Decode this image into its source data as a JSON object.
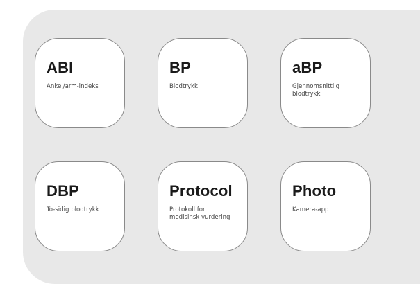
{
  "tiles": [
    {
      "title": "ABI",
      "description": "Ankel/arm-indeks"
    },
    {
      "title": "BP",
      "description": "Blodtrykk"
    },
    {
      "title": "aBP",
      "description": "Gjennomsnittlig\nblodtrykk"
    },
    {
      "title": "DBP",
      "description": "To-sidig blodtrykk"
    },
    {
      "title": "Protocol",
      "description": "Protokoll for\nmedisinsk vurdering"
    },
    {
      "title": "Photo",
      "description": "Kamera-app"
    }
  ],
  "colors": {
    "panel_background": "#e8e8e8",
    "tile_background": "#ffffff",
    "tile_border": "#8a8a8a",
    "title_text": "#1a1a1a",
    "description_text": "#444444"
  }
}
